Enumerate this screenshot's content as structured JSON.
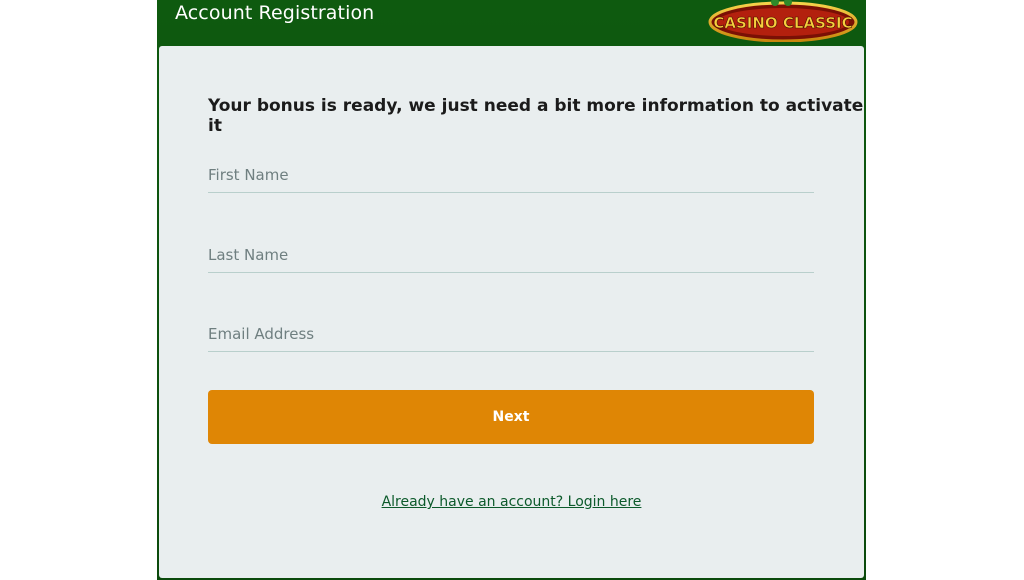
{
  "header": {
    "title": "Account Registration",
    "logo_text": "CASINO CLASSIC"
  },
  "form": {
    "subtitle": "Your bonus is ready, we just need a bit more information to activate it",
    "first_name_placeholder": "First Name",
    "last_name_placeholder": "Last Name",
    "email_placeholder": "Email Address",
    "next_label": "Next",
    "login_link": "Already have an account? Login here"
  },
  "colors": {
    "header_green": "#0e5a0f",
    "panel_bg": "#e9eeef",
    "button_orange": "#df8605",
    "link_green": "#0c5a2b"
  }
}
